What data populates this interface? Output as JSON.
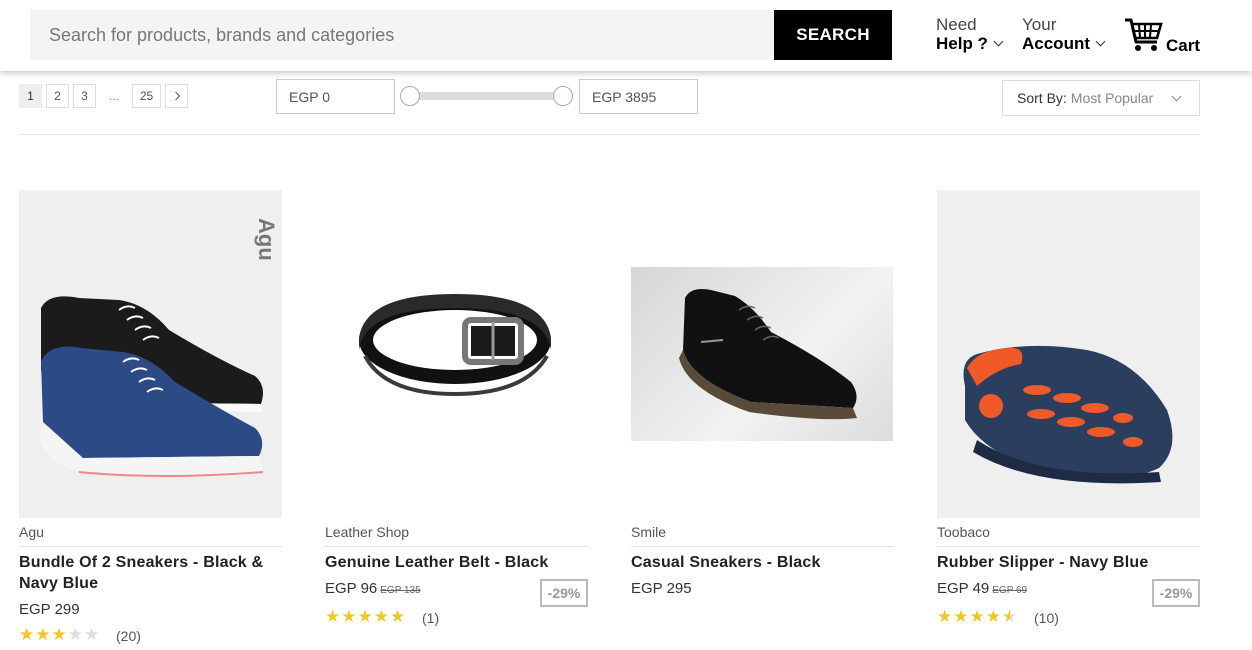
{
  "header": {
    "search_placeholder": "Search for products, brands and categories",
    "search_button": "SEARCH",
    "help_top": "Need",
    "help_bottom": "Help ?",
    "account_top": "Your",
    "account_bottom": "Account",
    "cart_label": "Cart",
    "cart_icon": "cart-icon"
  },
  "toolbar": {
    "pages": [
      "1",
      "2",
      "3",
      "...",
      "25"
    ],
    "active_page": "1",
    "price_min": "EGP 0",
    "price_max": "EGP 3895",
    "sort_label": "Sort By:",
    "sort_value": "Most Popular"
  },
  "products": [
    {
      "brand": "Agu",
      "title": "Bundle Of 2 Sneakers - Black & Navy Blue",
      "price": "EGP 299",
      "old_price": "",
      "discount": "",
      "rating": 3,
      "reviews": "(20)"
    },
    {
      "brand": "Leather Shop",
      "title": "Genuine Leather Belt - Black",
      "price": "EGP 96",
      "old_price": "EGP 135",
      "discount": "-29%",
      "rating": 5,
      "reviews": "(1)"
    },
    {
      "brand": "Smile",
      "title": "Casual Sneakers - Black",
      "price": "EGP 295",
      "old_price": "",
      "discount": "",
      "rating": 0,
      "reviews": ""
    },
    {
      "brand": "Toobaco",
      "title": "Rubber Slipper - Navy Blue",
      "price": "EGP 49",
      "old_price": "EGP 69",
      "discount": "-29%",
      "rating": 4.5,
      "reviews": "(10)"
    }
  ],
  "colors": {
    "accent": "#000000",
    "star": "#f3c623"
  }
}
